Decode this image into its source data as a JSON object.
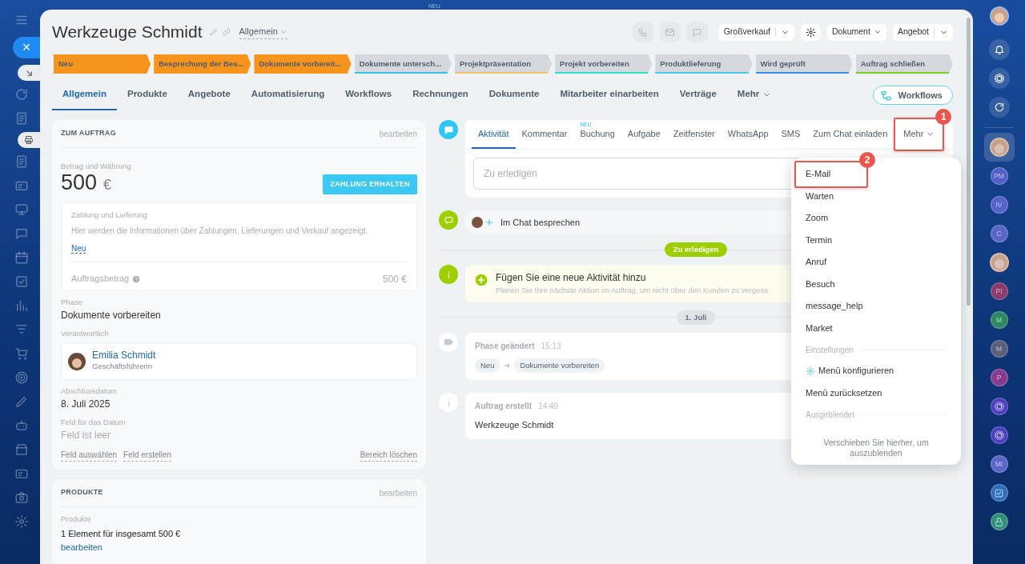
{
  "top_badge": "NEU",
  "close_button": "×",
  "rail_items": [
    {
      "kind": "photo",
      "selected": true
    },
    {
      "kind": "initials",
      "text": "PM",
      "color": "#5260c8",
      "selected": false
    },
    {
      "kind": "initials",
      "text": "IV",
      "color": "#5662c9",
      "selected": false
    },
    {
      "kind": "initials",
      "text": "C",
      "color": "#5b66c8",
      "selected": false
    },
    {
      "kind": "photo",
      "selected": false
    },
    {
      "kind": "initials",
      "text": "PI",
      "color": "#8a3c6a",
      "selected": false
    },
    {
      "kind": "initials",
      "text": "M",
      "color": "#2e8a5e",
      "selected": false
    },
    {
      "kind": "initials",
      "text": "M",
      "color": "#5a5f7a",
      "selected": false
    },
    {
      "kind": "initials",
      "text": "P",
      "color": "#8a3b8f",
      "selected": false
    },
    {
      "kind": "channel",
      "selected": false
    },
    {
      "kind": "channel",
      "selected": false
    },
    {
      "kind": "initials",
      "text": "MI",
      "color": "#5b66c8",
      "selected": false
    },
    {
      "kind": "task",
      "selected": false
    },
    {
      "kind": "locked",
      "selected": false
    }
  ],
  "title": "Werkzeuge Schmidt",
  "category": "Allgemein",
  "header_buttons": [
    {
      "kind": "split",
      "label": "Großverkauf"
    },
    {
      "kind": "gear"
    },
    {
      "kind": "dropdown",
      "label": "Dokument"
    },
    {
      "kind": "split",
      "label": "Angebot"
    }
  ],
  "stages": [
    {
      "label": "Neu",
      "reached": true,
      "color": "#f7941d"
    },
    {
      "label": "Besprechung der Bes...",
      "reached": true,
      "color": "#f7941d"
    },
    {
      "label": "Dokumente vorbereit...",
      "reached": true,
      "color": "#f7941d"
    },
    {
      "label": "Dokumente untersch...",
      "reached": false,
      "color": "#39c0ea"
    },
    {
      "label": "Projektpräsentation",
      "reached": false,
      "color": "#f5c26b"
    },
    {
      "label": "Projekt vorbereiten",
      "reached": false,
      "color": "#2fe0c8"
    },
    {
      "label": "Produktlieferung",
      "reached": false,
      "color": "#47c8ee"
    },
    {
      "label": "Wird geprüft",
      "reached": false,
      "color": "#3a8ef0"
    },
    {
      "label": "Auftrag schließen",
      "reached": false,
      "color": "#7acc1a"
    }
  ],
  "tabs": [
    {
      "label": "Allgemein",
      "kind": "tab",
      "selected": true
    },
    {
      "label": "Produkte",
      "kind": "tab",
      "selected": false
    },
    {
      "label": "Angebote",
      "kind": "tab",
      "selected": false
    },
    {
      "label": "Automatisierung",
      "kind": "tab",
      "selected": false
    },
    {
      "label": "Workflows",
      "kind": "tab",
      "selected": false
    },
    {
      "label": "Rechnungen",
      "kind": "tab",
      "selected": false
    },
    {
      "label": "Dokumente",
      "kind": "tab",
      "selected": false
    },
    {
      "label": "Mitarbeiter einarbeiten",
      "kind": "tab",
      "selected": false
    },
    {
      "label": "Verträge",
      "kind": "tab",
      "selected": false
    },
    {
      "label": "Mehr",
      "kind": "dropdown",
      "selected": false
    }
  ],
  "workflows_button": "Workflows",
  "order_card": {
    "heading": "ZUM AUFTRAG",
    "edit": "bearbeiten",
    "amount_label": "Betrag und Währung",
    "amount": "500",
    "currency": "€",
    "pay_button": "ZAHLUNG ERHALTEN",
    "payment_box": {
      "title": "Zahlung und Lieferung",
      "text": "Hier werden die Informationen über Zahlungen, Lieferungen und Verkauf angezeigt.",
      "new_link": "Neu",
      "total_label": "Auftragsbetrag",
      "total": "500 €"
    },
    "fields": [
      {
        "kind": "text",
        "label": "Phase",
        "value": "Dokumente vorbereiten"
      },
      {
        "kind": "person",
        "label": "Verantwortlich",
        "name": "Emilia Schmidt",
        "role": "Geschäftsführerin"
      },
      {
        "kind": "text",
        "label": "Abschlussdatum",
        "value": "8. Juli 2025"
      },
      {
        "kind": "empty",
        "label": "Feld für das Datum",
        "value": "Feld ist leer"
      }
    ],
    "footer_links": [
      "Feld auswählen",
      "Feld erstellen"
    ],
    "clear_link": "Bereich löschen"
  },
  "products_card": {
    "heading": "PRODUKTE",
    "edit": "bearbeiten",
    "label": "Produkte",
    "summary": "1 Element für insgesamt 500 €",
    "link": "bearbeiten"
  },
  "activity_tabs": [
    {
      "label": "Aktivität",
      "kind": "tab",
      "selected": true
    },
    {
      "label": "Kommentar",
      "kind": "tab",
      "selected": false
    },
    {
      "label": "Buchung",
      "kind": "tab",
      "selected": false,
      "badge": "NEU"
    },
    {
      "label": "Aufgabe",
      "kind": "tab",
      "selected": false
    },
    {
      "label": "Zeitfenster",
      "kind": "tab",
      "selected": false
    },
    {
      "label": "WhatsApp",
      "kind": "tab",
      "selected": false
    },
    {
      "label": "SMS",
      "kind": "tab",
      "selected": false
    },
    {
      "label": "Zum Chat einladen",
      "kind": "tab",
      "selected": false
    },
    {
      "label": "Mehr",
      "kind": "dropdown",
      "selected": false,
      "callout": "1"
    }
  ],
  "todo_placeholder": "Zu erledigen",
  "chat_item": "Im Chat besprechen",
  "todo_divider": "Zu erledigen",
  "suggestion": {
    "title": "Fügen Sie eine neue Aktivität hinzu",
    "text": "Planen Sie Ihre nächste Aktion im Auftrag, um nicht über den Kunden zu vergess"
  },
  "date_divider": "1. Juli",
  "history": [
    {
      "kind": "phase",
      "title": "Phase geändert",
      "time": "15:13",
      "from": "Neu",
      "to": "Dokumente vorbereiten"
    },
    {
      "kind": "created",
      "title": "Auftrag erstellt",
      "time": "14:49",
      "text": "Werkzeuge Schmidt"
    }
  ],
  "more_menu": {
    "items": [
      {
        "label": "E-Mail",
        "callout": "2"
      },
      {
        "label": "Warten"
      },
      {
        "label": "Zoom"
      },
      {
        "label": "Termin"
      },
      {
        "label": "Anruf"
      },
      {
        "label": "Besuch"
      },
      {
        "label": "message_help"
      },
      {
        "label": "Market"
      }
    ],
    "settings_heading": "Einstellungen",
    "settings": [
      {
        "kind": "gear",
        "label": "Menü konfigurieren"
      },
      {
        "kind": "plain",
        "label": "Menü zurücksetzen"
      }
    ],
    "hidden_heading": "Ausgeblendet",
    "hidden_hint": "Verschieben Sie hierher, um auszublenden"
  }
}
